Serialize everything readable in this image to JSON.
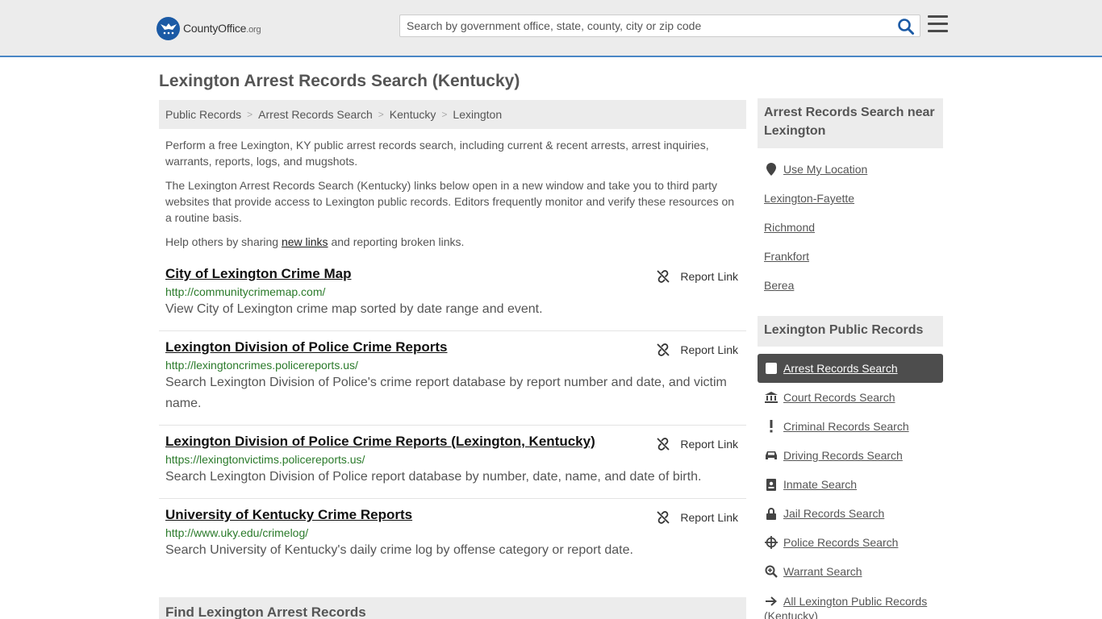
{
  "header": {
    "logo_name": "CountyOffice",
    "logo_tld": ".org",
    "search_placeholder": "Search by government office, state, county, city or zip code"
  },
  "page_title": "Lexington Arrest Records Search (Kentucky)",
  "breadcrumb": [
    "Public Records",
    "Arrest Records Search",
    "Kentucky",
    "Lexington"
  ],
  "intro": {
    "p1": "Perform a free Lexington, KY public arrest records search, including current & recent arrests, arrest inquiries, warrants, reports, logs, and mugshots.",
    "p2": "The Lexington Arrest Records Search (Kentucky) links below open in a new window and take you to third party websites that provide access to Lexington public records. Editors frequently monitor and verify these resources on a routine basis.",
    "p3_before": "Help others by sharing ",
    "p3_link": "new links",
    "p3_after": " and reporting broken links."
  },
  "report_label": "Report Link",
  "results": [
    {
      "title": "City of Lexington Crime Map",
      "url": "http://communitycrimemap.com/",
      "desc": "View City of Lexington crime map sorted by date range and event."
    },
    {
      "title": "Lexington Division of Police Crime Reports",
      "url": "http://lexingtoncrimes.policereports.us/",
      "desc": "Search Lexington Division of Police's crime report database by report number and date, and victim name."
    },
    {
      "title": "Lexington Division of Police Crime Reports (Lexington, Kentucky)",
      "url": "https://lexingtonvictims.policereports.us/",
      "desc": "Search Lexington Division of Police report database by number, date, name, and date of birth."
    },
    {
      "title": "University of Kentucky Crime Reports",
      "url": "http://www.uky.edu/crimelog/",
      "desc": "Search University of Kentucky's daily crime log by offense category or report date."
    }
  ],
  "find_heading": "Find Lexington Arrest Records",
  "sidebar": {
    "near_heading": "Arrest Records Search near Lexington",
    "use_location": "Use My Location",
    "near_items": [
      "Lexington-Fayette",
      "Richmond",
      "Frankfort",
      "Berea"
    ],
    "records_heading": "Lexington Public Records",
    "active_item": "Arrest Records Search",
    "record_items": [
      {
        "label": "Court Records Search",
        "icon": "courthouse-icon"
      },
      {
        "label": "Criminal Records Search",
        "icon": "exclamation-icon"
      },
      {
        "label": "Driving Records Search",
        "icon": "car-icon"
      },
      {
        "label": "Inmate Search",
        "icon": "id-badge-icon"
      },
      {
        "label": "Jail Records Search",
        "icon": "lock-icon"
      },
      {
        "label": "Police Records Search",
        "icon": "crosshair-icon"
      },
      {
        "label": "Warrant Search",
        "icon": "magnify-plus-icon"
      }
    ],
    "all_records": "All Lexington Public Records (Kentucky)"
  }
}
